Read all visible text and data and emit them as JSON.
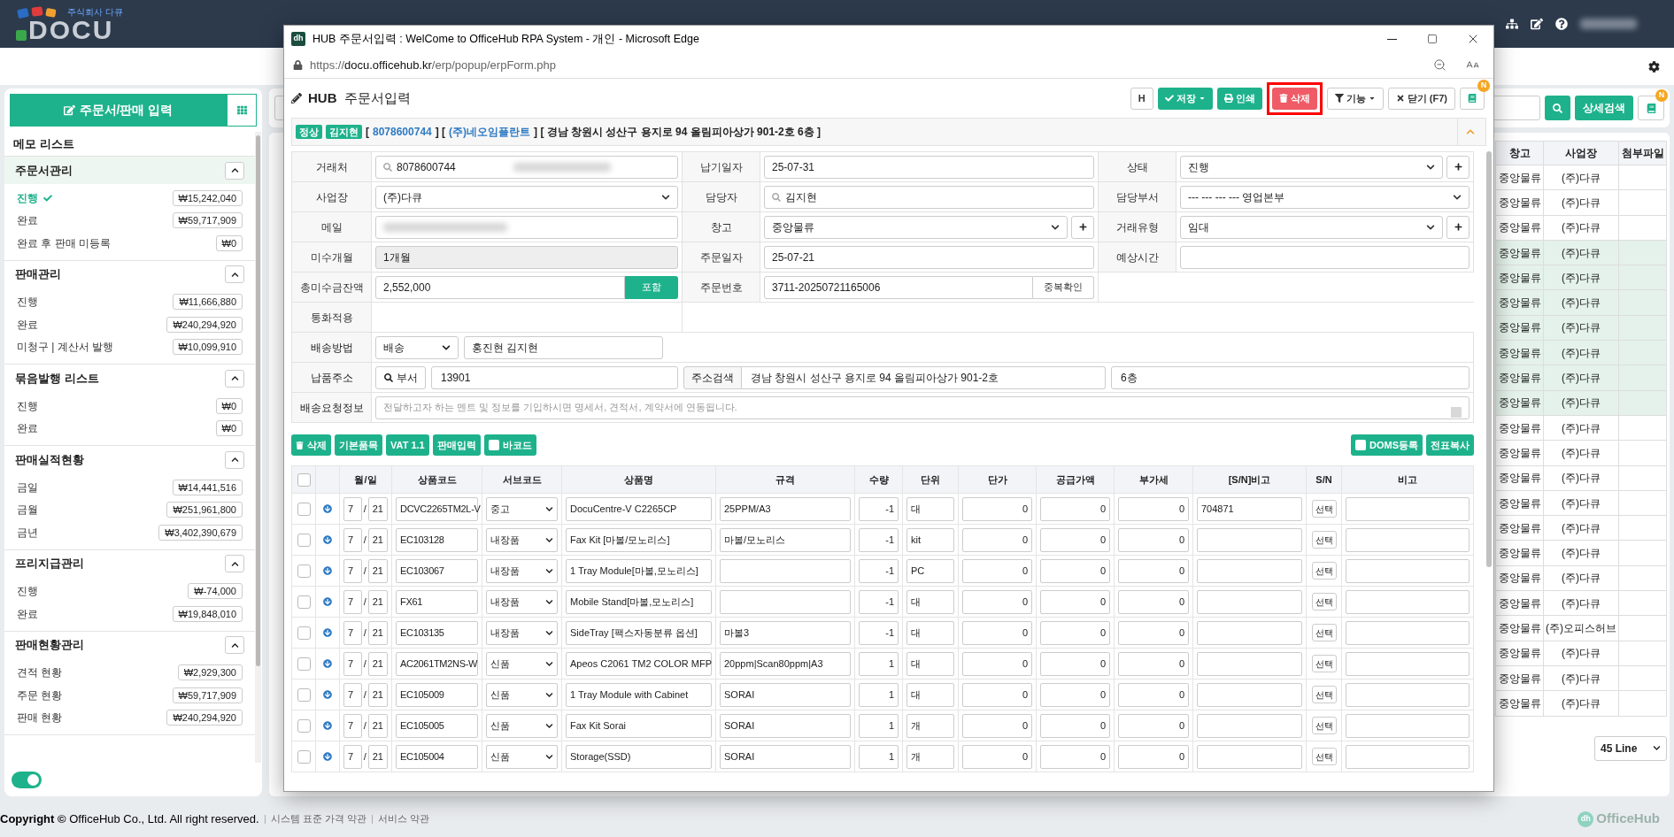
{
  "topbar": {
    "logo": "DOCU",
    "tagline": "주식회사 다큐",
    "user_blurred": true
  },
  "sidebar": {
    "primary_button": "주문서/판매 입력",
    "memo_heading": "메모 리스트",
    "toggle_on": true,
    "sections": [
      {
        "title": "주문서관리",
        "active": true,
        "expanded": true,
        "items": [
          {
            "label": "진행",
            "amount": "₩15,242,040",
            "selected": true
          },
          {
            "label": "완료",
            "amount": "₩59,717,909",
            "selected": false
          },
          {
            "label": "완료 후 판매 미등록",
            "amount": "₩0",
            "selected": false
          }
        ]
      },
      {
        "title": "판매관리",
        "active": false,
        "expanded": true,
        "items": [
          {
            "label": "진행",
            "amount": "₩11,666,880",
            "selected": false
          },
          {
            "label": "완료",
            "amount": "₩240,294,920",
            "selected": false
          },
          {
            "label": "미청구 | 계산서 발행",
            "amount": "₩10,099,910",
            "selected": false
          }
        ]
      },
      {
        "title": "묶음발행 리스트",
        "active": false,
        "expanded": true,
        "items": [
          {
            "label": "진행",
            "amount": "₩0",
            "selected": false
          },
          {
            "label": "완료",
            "amount": "₩0",
            "selected": false
          }
        ]
      },
      {
        "title": "판매실적현황",
        "active": false,
        "expanded": true,
        "items": [
          {
            "label": "금일",
            "amount": "₩14,441,516",
            "selected": false
          },
          {
            "label": "금월",
            "amount": "₩251,961,800",
            "selected": false
          },
          {
            "label": "금년",
            "amount": "₩3,402,390,679",
            "selected": false
          }
        ]
      },
      {
        "title": "프리지급관리",
        "active": false,
        "expanded": true,
        "items": [
          {
            "label": "진행",
            "amount": "₩-74,000",
            "selected": false
          },
          {
            "label": "완료",
            "amount": "₩19,848,010",
            "selected": false
          }
        ]
      },
      {
        "title": "판매현황관리",
        "active": false,
        "expanded": true,
        "items": [
          {
            "label": "견적 현황",
            "amount": "₩2,929,300",
            "selected": false
          },
          {
            "label": "주문 현황",
            "amount": "₩59,717,909",
            "selected": false
          },
          {
            "label": "판매 현황",
            "amount": "₩240,294,920",
            "selected": false
          }
        ]
      }
    ]
  },
  "main": {
    "search_button": "상세검색",
    "book_badge": "N",
    "page_size": "45 Line",
    "table": {
      "columns": [
        "창고",
        "사업장",
        "첨부파일"
      ],
      "rows": [
        {
          "warehouse": "중앙물류",
          "site": "(주)다큐",
          "highlighted": false
        },
        {
          "warehouse": "중앙물류",
          "site": "(주)다큐",
          "highlighted": false
        },
        {
          "warehouse": "중앙물류",
          "site": "(주)다큐",
          "highlighted": false
        },
        {
          "warehouse": "중앙물류",
          "site": "(주)다큐",
          "highlighted": true
        },
        {
          "warehouse": "중앙물류",
          "site": "(주)다큐",
          "highlighted": true
        },
        {
          "warehouse": "중앙물류",
          "site": "(주)다큐",
          "highlighted": true
        },
        {
          "warehouse": "중앙물류",
          "site": "(주)다큐",
          "highlighted": true
        },
        {
          "warehouse": "중앙물류",
          "site": "(주)다큐",
          "highlighted": true
        },
        {
          "warehouse": "중앙물류",
          "site": "(주)다큐",
          "highlighted": true
        },
        {
          "warehouse": "중앙물류",
          "site": "(주)다큐",
          "highlighted": true
        },
        {
          "warehouse": "중앙물류",
          "site": "(주)다큐",
          "highlighted": false
        },
        {
          "warehouse": "중앙물류",
          "site": "(주)다큐",
          "highlighted": false
        },
        {
          "warehouse": "중앙물류",
          "site": "(주)다큐",
          "highlighted": false
        },
        {
          "warehouse": "중앙물류",
          "site": "(주)다큐",
          "highlighted": false
        },
        {
          "warehouse": "중앙물류",
          "site": "(주)다큐",
          "highlighted": false
        },
        {
          "warehouse": "중앙물류",
          "site": "(주)다큐",
          "highlighted": false
        },
        {
          "warehouse": "중앙물류",
          "site": "(주)다큐",
          "highlighted": false
        },
        {
          "warehouse": "중앙물류",
          "site": "(주)다큐",
          "highlighted": false
        },
        {
          "warehouse": "중앙물류",
          "site": "(주)오피스허브",
          "highlighted": false
        },
        {
          "warehouse": "중앙물류",
          "site": "(주)다큐",
          "highlighted": false
        },
        {
          "warehouse": "중앙물류",
          "site": "(주)다큐",
          "highlighted": false
        },
        {
          "warehouse": "중앙물류",
          "site": "(주)다큐",
          "highlighted": false
        }
      ]
    }
  },
  "footer": {
    "copyright": "**Copyright ©** OfficeHub Co., Ltd. All right reserved.",
    "links": [
      "시스템 표준 가격 약관",
      "서비스 약관"
    ],
    "brand_mark": "dh",
    "brand": "OfficeHub"
  },
  "popup": {
    "app_icon": "dh",
    "window_title": "HUB 주문서입력 : WelCome to OfficeHub RPA System - 개인 - Microsoft Edge",
    "url": [
      {
        "text": "https://",
        "strong": false
      },
      {
        "text": "docu.officehub.kr",
        "strong": true
      },
      {
        "text": "/erp/popup/erpForm.php",
        "strong": false
      }
    ],
    "heading": {
      "brand": "HUB",
      "title": "주문서입력"
    },
    "toolbar": [
      {
        "label": "H",
        "kind": "plain",
        "highlighted": false
      },
      {
        "label": "저장",
        "kind": "save",
        "highlighted": false
      },
      {
        "label": "인쇄",
        "kind": "print",
        "highlighted": false
      },
      {
        "label": "삭제",
        "kind": "delete",
        "highlighted": true
      },
      {
        "label": "기능",
        "kind": "function",
        "highlighted": false
      },
      {
        "label": "닫기 (F7)",
        "kind": "close",
        "highlighted": false
      },
      {
        "kind": "book",
        "badge": "N",
        "highlighted": false
      }
    ],
    "info": {
      "badges": [
        "정상",
        "김지현"
      ],
      "segments": [
        {
          "text": "[",
          "link": false
        },
        {
          "text": "8078600744",
          "link": true
        },
        {
          "text": "] [",
          "link": false
        },
        {
          "text": "(주)네오임플란트",
          "link": true
        },
        {
          "text": "] [ 경남 창원시 성산구 용지로 94 올림피아상가 901-2호 6층 ]",
          "link": false
        }
      ],
      "expanded": true
    },
    "form": {
      "rows": [
        [
          {
            "label": "거래처",
            "kind": "search",
            "value": "8078600744",
            "blurred": true
          },
          {
            "label": "납기일자",
            "kind": "text",
            "value": "25-07-31"
          },
          {
            "label": "상태",
            "kind": "select",
            "value": "진행",
            "add": true
          }
        ],
        [
          {
            "label": "사업장",
            "kind": "select",
            "value": "(주)다큐"
          },
          {
            "label": "담당자",
            "kind": "search",
            "value": "김지현"
          },
          {
            "label": "담당부서",
            "kind": "select",
            "value": "--- --- --- --- 영업본부"
          }
        ],
        [
          {
            "label": "메일",
            "kind": "text",
            "blurred": true
          },
          {
            "label": "창고",
            "kind": "select",
            "value": "중앙물류",
            "add": true
          },
          {
            "label": "거래유형",
            "kind": "select",
            "value": "임대",
            "add": true
          }
        ],
        [
          {
            "label": "미수개월",
            "kind": "readonly",
            "value": "1개월"
          },
          {
            "label": "주문일자",
            "kind": "text",
            "value": "25-07-21"
          },
          {
            "label": "예상시간",
            "kind": "text"
          }
        ],
        [
          {
            "label": "총미수금잔액",
            "kind": "button_field",
            "value": "2,552,000",
            "button": {
              "label": "포함",
              "kind": "primary"
            }
          },
          {
            "label": "주문번호",
            "kind": "button_field",
            "value": "3711-20250721165006",
            "button": {
              "label": "중복확인",
              "kind": "default"
            }
          }
        ],
        [
          {
            "label": "통화적용",
            "kind": "none"
          }
        ]
      ],
      "delivery": {
        "label": "배송방법",
        "method": "배송",
        "recipient": "홍진현 김지현"
      },
      "address": {
        "label": "납품주소",
        "dept_button": "부서",
        "zip": "13901",
        "search_button": "주소검색",
        "address": "경남 창원시 성산구 용지로 94 올림피아상가 901-2호",
        "detail": "6층"
      },
      "request": {
        "label": "배송요청정보",
        "placeholder": "전달하고자 하는 멘트 및 정보를 기입하시면 명세서, 견적서, 계약서에 연동됩니다."
      }
    },
    "item_toolbar": {
      "left": [
        {
          "label": "삭제",
          "kind": "delete"
        },
        {
          "label": "기본품목",
          "kind": "plain"
        },
        {
          "label": "VAT 1.1",
          "kind": "plain"
        },
        {
          "label": "판매입력",
          "kind": "plain"
        },
        {
          "label": "바코드",
          "kind": "checkbox",
          "checked": false
        }
      ],
      "right": [
        {
          "label": "DOMS등록",
          "kind": "checkbox",
          "checked": false
        },
        {
          "label": "전표복사",
          "kind": "plain"
        }
      ]
    },
    "items": {
      "header_checked": false,
      "date_separator": "/",
      "columns": [
        "월/일",
        "상품코드",
        "서브코드",
        "상품명",
        "규격",
        "수량",
        "단위",
        "단가",
        "공급가액",
        "부가세",
        "[S/N]비고",
        "S/N",
        "비고"
      ],
      "rows": [
        {
          "checked": false,
          "month": "7",
          "day": "21",
          "code": "DCVC2265TM2L-V",
          "sub": "중고",
          "name": "DocuCentre-V C2265CP",
          "spec": "25PPM/A3",
          "qty": "-1",
          "unit": "대",
          "price": "0",
          "supply": "0",
          "vat": "0",
          "sn_note": "704871",
          "sn_button": "선택"
        },
        {
          "checked": false,
          "month": "7",
          "day": "21",
          "code": "EC103128",
          "sub": "내장품",
          "name": "Fax Kit [마볼/모노리스]",
          "spec": "마볼/모노리스",
          "qty": "-1",
          "unit": "kit",
          "price": "0",
          "supply": "0",
          "vat": "0",
          "sn_button": "선택"
        },
        {
          "checked": false,
          "month": "7",
          "day": "21",
          "code": "EC103067",
          "sub": "내장품",
          "name": "1 Tray Module[마볼,모노리스]",
          "qty": "-1",
          "unit": "PC",
          "price": "0",
          "supply": "0",
          "vat": "0",
          "sn_button": "선택"
        },
        {
          "checked": false,
          "month": "7",
          "day": "21",
          "code": "FX61",
          "sub": "내장품",
          "name": "Mobile Stand[마볼,모노리스]",
          "qty": "-1",
          "unit": "대",
          "price": "0",
          "supply": "0",
          "vat": "0",
          "sn_button": "선택"
        },
        {
          "checked": false,
          "month": "7",
          "day": "21",
          "code": "EC103135",
          "sub": "내장품",
          "name": "SideTray [팩스자동분류 옵션]",
          "spec": "마볼3",
          "qty": "-1",
          "unit": "대",
          "price": "0",
          "supply": "0",
          "vat": "0",
          "sn_button": "선택"
        },
        {
          "checked": false,
          "month": "7",
          "day": "21",
          "code": "AC2061TM2NS-W",
          "sub": "신품",
          "name": "Apeos C2061 TM2 COLOR MFP",
          "spec": "20ppm|Scan80ppm|A3",
          "qty": "1",
          "unit": "대",
          "price": "0",
          "supply": "0",
          "vat": "0",
          "sn_button": "선택"
        },
        {
          "checked": false,
          "month": "7",
          "day": "21",
          "code": "EC105009",
          "sub": "신품",
          "name": "1 Tray Module with Cabinet",
          "spec": "SORAI",
          "qty": "1",
          "unit": "대",
          "price": "0",
          "supply": "0",
          "vat": "0",
          "sn_button": "선택"
        },
        {
          "checked": false,
          "month": "7",
          "day": "21",
          "code": "EC105005",
          "sub": "신품",
          "name": "Fax Kit Sorai",
          "spec": "SORAI",
          "qty": "1",
          "unit": "개",
          "price": "0",
          "supply": "0",
          "vat": "0",
          "sn_button": "선택"
        },
        {
          "checked": false,
          "month": "7",
          "day": "21",
          "code": "EC105004",
          "sub": "신품",
          "name": "Storage(SSD)",
          "spec": "SORAI",
          "qty": "1",
          "unit": "개",
          "price": "0",
          "supply": "0",
          "vat": "0",
          "sn_button": "선택"
        }
      ]
    }
  }
}
